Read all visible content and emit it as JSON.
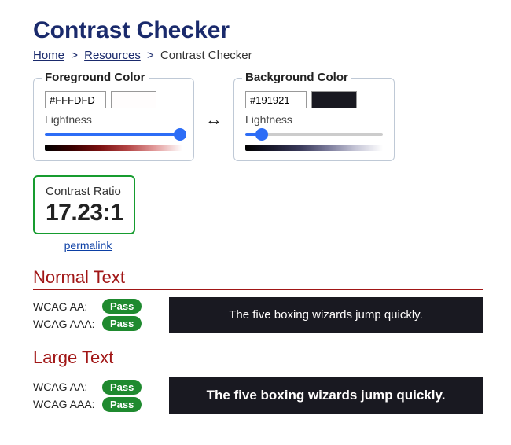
{
  "title": "Contrast Checker",
  "breadcrumb": {
    "home": "Home",
    "resources": "Resources",
    "current": "Contrast Checker",
    "sep": ">"
  },
  "foreground": {
    "legend": "Foreground Color",
    "hex": "#FFFDFD",
    "swatch": "#fffdfd",
    "lightness_label": "Lightness",
    "lightness_pct": 98,
    "hue_gradient": "linear-gradient(to right, #000000, #3a0000, #7a1010, #b34444, #e29b9b, #ffffff)"
  },
  "background": {
    "legend": "Background Color",
    "hex": "#191921",
    "swatch": "#191921",
    "lightness_label": "Lightness",
    "lightness_pct": 12,
    "hue_gradient": "linear-gradient(to right, #000000, #1a1a2e, #3a3a5a, #7a7a9a, #c5c5d6, #ffffff)"
  },
  "swap_glyph": "↔",
  "ratio": {
    "title": "Contrast Ratio",
    "value": "17.23",
    "suffix": ":1",
    "permalink": "permalink"
  },
  "normal": {
    "heading": "Normal Text",
    "aa_label": "WCAG AA:",
    "aa_result": "Pass",
    "aaa_label": "WCAG AAA:",
    "aaa_result": "Pass",
    "sample": "The five boxing wizards jump quickly."
  },
  "large": {
    "heading": "Large Text",
    "aa_label": "WCAG AA:",
    "aa_result": "Pass",
    "aaa_label": "WCAG AAA:",
    "aaa_result": "Pass",
    "sample": "The five boxing wizards jump quickly."
  }
}
